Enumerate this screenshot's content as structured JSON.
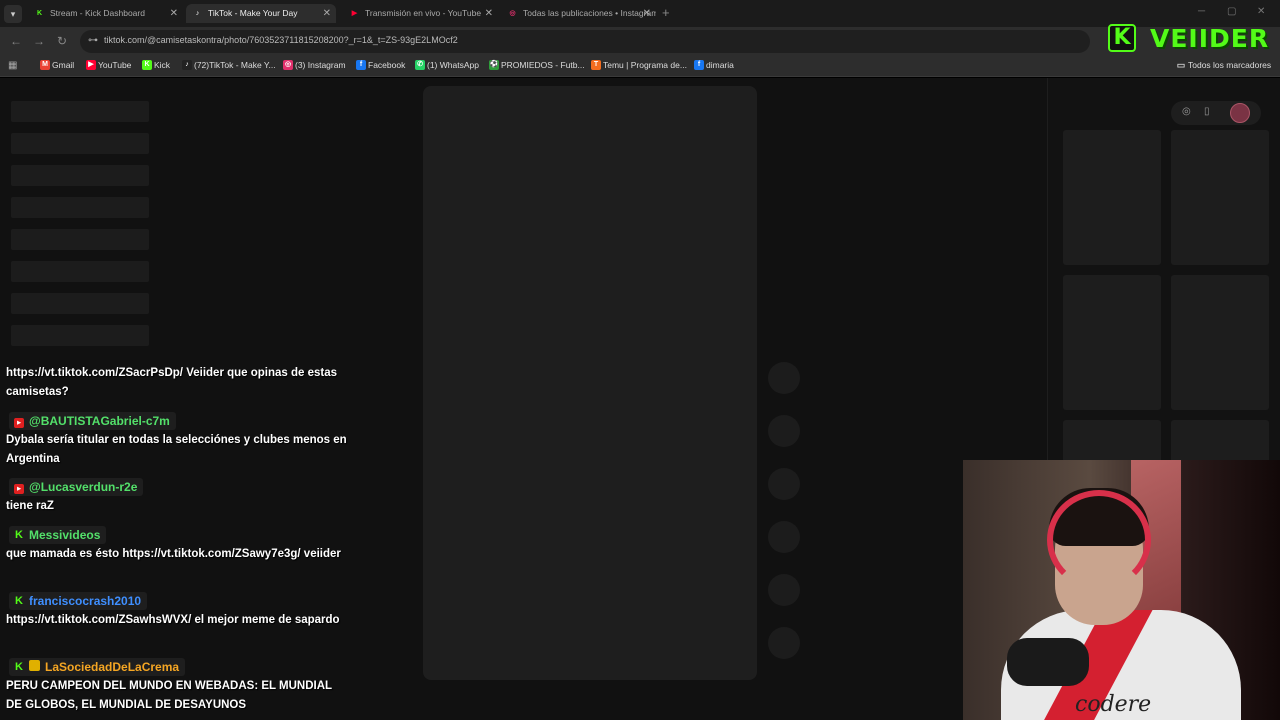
{
  "tabs": [
    {
      "title": "Stream - Kick Dashboard",
      "icon": "kick-icon",
      "color": "#53fc18",
      "glyph": "K"
    },
    {
      "title": "TikTok - Make Your Day",
      "icon": "tiktok-icon",
      "color": "#ffffff",
      "glyph": "♪"
    },
    {
      "title": "Transmisión en vivo - YouTube",
      "icon": "youtube-icon",
      "color": "#ff0033",
      "glyph": "▶"
    },
    {
      "title": "Todas las publicaciones • Instagram",
      "icon": "instagram-icon",
      "color": "#e1306c",
      "glyph": "◎"
    }
  ],
  "address": {
    "url": "tiktok.com/@camisetaskontra/photo/7603523711815208200?_r=1&_t=ZS-93gE2LMOcf2"
  },
  "bookmarks": [
    {
      "label": "Gmail",
      "icon": "gmail-icon",
      "color": "#ea4335",
      "glyph": "M"
    },
    {
      "label": "YouTube",
      "icon": "youtube-icon",
      "color": "#ff0033",
      "glyph": "▶"
    },
    {
      "label": "Kick",
      "icon": "kick-icon",
      "color": "#53fc18",
      "glyph": "K"
    },
    {
      "label": "(72)TikTok - Make Y...",
      "icon": "tiktok-icon",
      "color": "#222222",
      "glyph": "♪"
    },
    {
      "label": "(3) Instagram",
      "icon": "instagram-icon",
      "color": "#e1306c",
      "glyph": "◎"
    },
    {
      "label": "Facebook",
      "icon": "facebook-icon",
      "color": "#1877f2",
      "glyph": "f"
    },
    {
      "label": "(1) WhatsApp",
      "icon": "whatsapp-icon",
      "color": "#25d366",
      "glyph": "✆"
    },
    {
      "label": "PROMIEDOS - Futb...",
      "icon": "promiedos-icon",
      "color": "#2e9d3a",
      "glyph": "⚽"
    },
    {
      "label": "Temu | Programa de...",
      "icon": "temu-icon",
      "color": "#f46d1e",
      "glyph": "T"
    },
    {
      "label": "dimaria",
      "icon": "facebook-icon",
      "color": "#1877f2",
      "glyph": "f"
    }
  ],
  "bookmarks_all": "Todos los marcadores",
  "logo": {
    "letter": "K",
    "name": "VEIIDER",
    "color": "#53fc18"
  },
  "chat": {
    "first_message": "https://vt.tiktok.com/ZSacrPsDp/ Veiider que opinas de estas camisetas?",
    "messages": [
      {
        "platform": "youtube",
        "user": "@BAUTISTAGabriel-c7m",
        "user_color": "#53e06a",
        "text": "Dybala sería titular en todas la selecciónes y clubes menos en Argentina"
      },
      {
        "platform": "youtube",
        "user": "@Lucasverdun-r2e",
        "user_color": "#53e06a",
        "text": "tiene raZ"
      },
      {
        "platform": "kick",
        "user": "Messivideos",
        "user_color": "#53e06a",
        "text": "que mamada es ésto https://vt.tiktok.com/ZSawy7e3g/ veiider"
      },
      {
        "platform": "kick",
        "user": "franciscocrash2010",
        "user_color": "#3f8fff",
        "text": "https://vt.tiktok.com/ZSawhsWVX/ el mejor meme de sapardo"
      },
      {
        "platform": "kick",
        "user": "LaSociedadDeLaCrema",
        "user_color": "#f5a623",
        "subscriber": true,
        "text": "PERU CAMPEON DEL MUNDO EN WEBADAS: EL MUNDIAL DE GLOBOS, EL MUNDIAL DE DESAYUNOS"
      }
    ]
  },
  "webcam": {
    "sponsor": "codere"
  }
}
